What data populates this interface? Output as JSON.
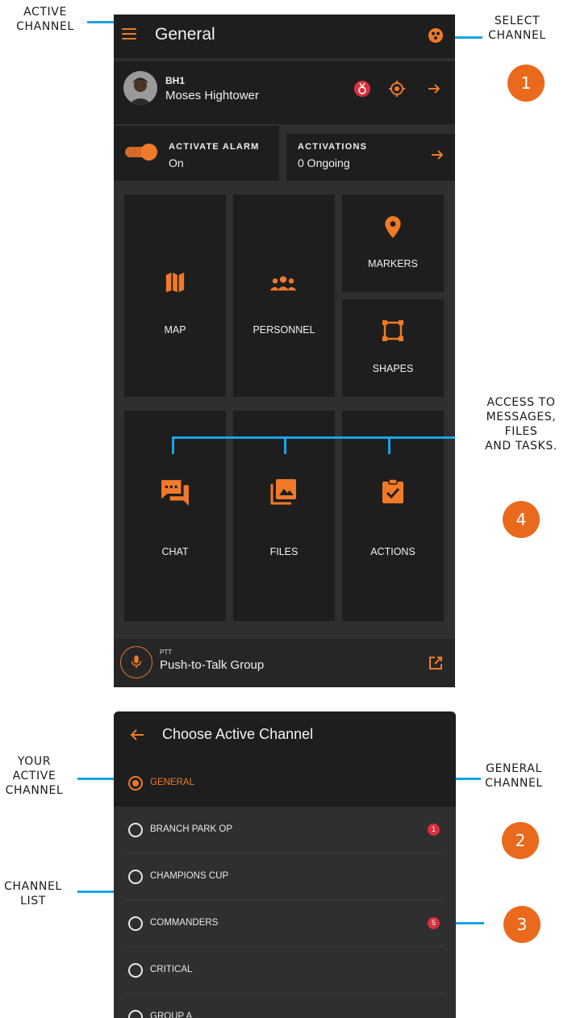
{
  "annotations": {
    "active_channel": "ACTIVE\nCHANNEL",
    "select_channel": "SELECT\nCHANNEL",
    "access": "ACCESS TO\nMESSAGES,\nFILES\nAND TASKS.",
    "your_active_channel": "YOUR\nACTIVE\nCHANNEL",
    "general_channel": "GENERAL\nCHANNEL",
    "channel_list": "CHANNEL\nLIST",
    "badges": [
      "1",
      "2",
      "3",
      "4"
    ]
  },
  "colors": {
    "accent": "#f07a28",
    "badge": "#ea6a1d",
    "leader": "#1aa3e8",
    "unread": "#d9303c"
  },
  "header": {
    "title": "General",
    "menu_icon": "hamburger-icon",
    "select_icon": "channels-icon"
  },
  "user": {
    "callsign": "BH1",
    "name": "Moses Hightower"
  },
  "alarm": {
    "label": "ACTIVATE ALARM",
    "value": "On",
    "toggle_on": true
  },
  "activations": {
    "label": "ACTIVATIONS",
    "value": "0 Ongoing"
  },
  "tiles": {
    "map": "MAP",
    "personnel": "PERSONNEL",
    "markers": "MARKERS",
    "shapes": "SHAPES",
    "chat": "CHAT",
    "files": "FILES",
    "actions": "ACTIONS"
  },
  "ptt": {
    "kicker": "PTT",
    "name": "Push-to-Talk Group"
  },
  "chooser": {
    "title": "Choose Active Channel",
    "channels": [
      {
        "name": "GENERAL",
        "selected": true
      },
      {
        "name": "BRANCH PARK OP",
        "unread": "1"
      },
      {
        "name": "CHAMPIONS CUP"
      },
      {
        "name": "COMMANDERS",
        "unread": "5"
      },
      {
        "name": "CRITICAL"
      },
      {
        "name": "GROUP A"
      }
    ]
  }
}
